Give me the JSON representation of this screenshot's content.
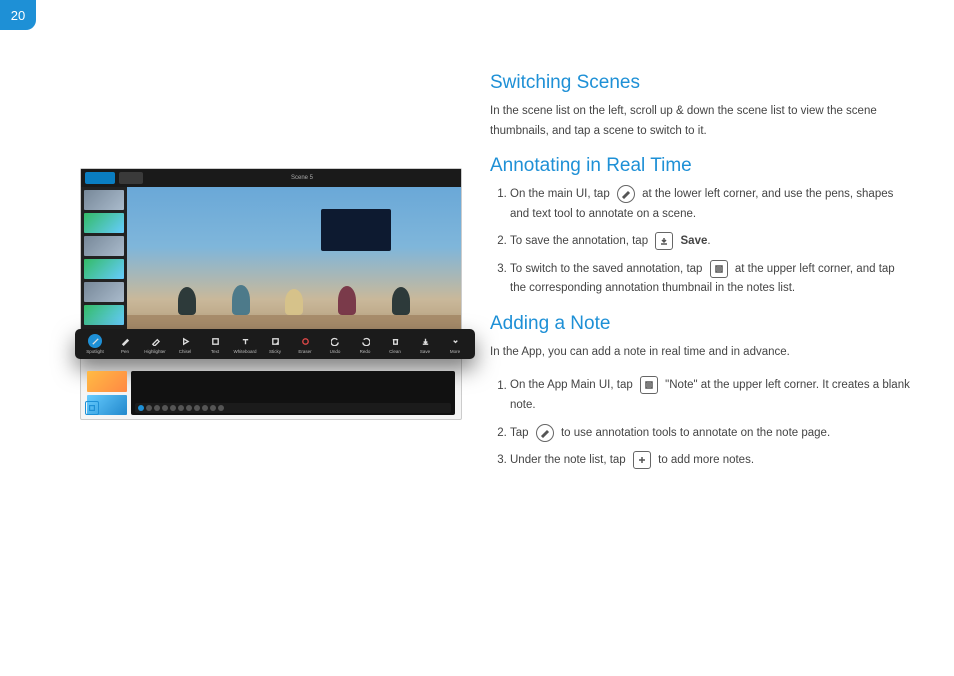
{
  "page_number": "20",
  "sections": {
    "switching": {
      "title": "Switching Scenes",
      "body": "In the scene list on the left, scroll up & down the scene list to view the scene thumbnails, and tap a scene to switch to it."
    },
    "annotating": {
      "title": "Annotating in Real Time",
      "step1a": "On the main UI, tap",
      "step1b": "at the lower left corner, and use the pens, shapes and text tool to annotate on a scene.",
      "step2a": "To save the annotation, tap",
      "step2b": "Save",
      "step2c": ".",
      "step3a": "To switch to the saved annotation, tap",
      "step3b": "at the upper left corner, and tap the corresponding annotation thumbnail in the notes list."
    },
    "adding": {
      "title": "Adding a Note",
      "intro": "In the App, you can add a note in real time and in advance.",
      "step1a": "On the App Main UI, tap",
      "step1b": "\"Note\" at the upper left corner. It creates a blank note.",
      "step2a": "Tap",
      "step2b": "to use annotation tools to annotate on the note page.",
      "step3a": "Under the note list, tap",
      "step3b": "to add more notes."
    }
  },
  "mock": {
    "scene_title": "Scene 5",
    "toolbar": [
      "Spotlight",
      "Pen",
      "Highlighter",
      "Chisel",
      "Text",
      "Whiteboard",
      "Sticky",
      "Eraser",
      "Undo",
      "Redo",
      "Clean",
      "Save",
      "More"
    ]
  }
}
